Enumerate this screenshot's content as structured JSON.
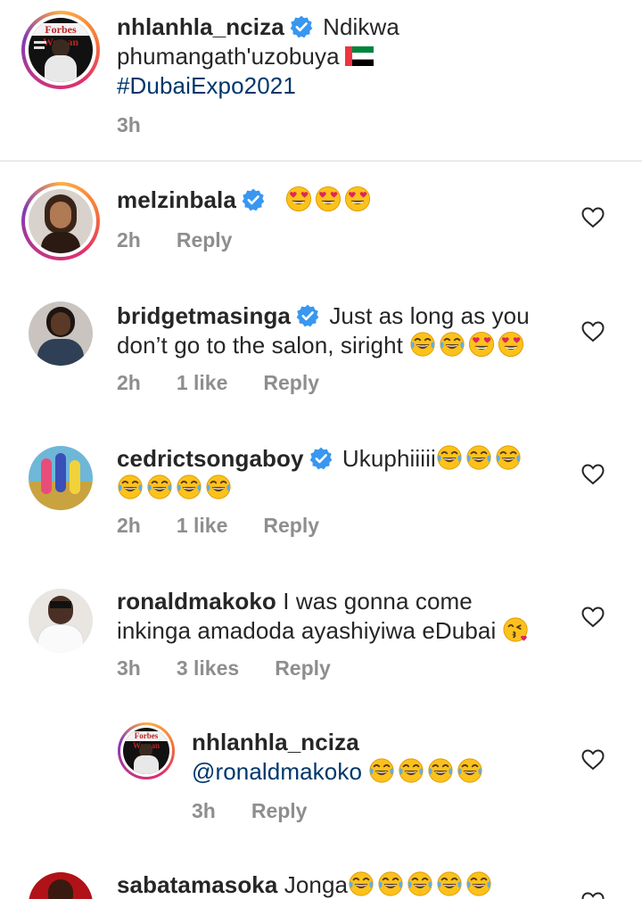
{
  "caption": {
    "username": "nhlanhla_nciza",
    "text_line1": "Ndikwa",
    "text_line2": "phumangath'uzobuya",
    "hashtag": "#DubaiExpo2021",
    "time": "3h",
    "avatar_label": "Forbes Woman"
  },
  "comments": [
    {
      "username": "melzinbala",
      "verified": true,
      "text": "",
      "emojis": [
        "heart-eyes",
        "heart-eyes",
        "heart-eyes"
      ],
      "time": "2h",
      "likes": "",
      "reply": "Reply"
    },
    {
      "username": "bridgetmasinga",
      "verified": true,
      "text_line1": "Just as long as you",
      "text_line2": "don’t go to the salon, siright",
      "emojis": [
        "tears-of-joy",
        "tears-of-joy",
        "heart-eyes",
        "heart-eyes"
      ],
      "time": "2h",
      "likes": "1 like",
      "reply": "Reply"
    },
    {
      "username": "cedrictsongaboy",
      "verified": true,
      "text_line1": "Ukuphiiiii",
      "emojis_line1": [
        "tears-of-joy",
        "tears-of-joy",
        "tears-of-joy"
      ],
      "emojis_line2": [
        "tears-of-joy",
        "tears-of-joy",
        "tears-of-joy",
        "tears-of-joy"
      ],
      "time": "2h",
      "likes": "1 like",
      "reply": "Reply"
    },
    {
      "username": "ronaldmakoko",
      "verified": false,
      "text_line1": "I was gonna come",
      "text_line2": "inkinga amadoda ayashiyiwa eDubai",
      "emojis": [
        "kissing-heart"
      ],
      "time": "3h",
      "likes": "3 likes",
      "reply": "Reply"
    },
    {
      "username": "nhlanhla_nciza",
      "verified": false,
      "mention": "@ronaldmakoko",
      "emojis": [
        "tears-of-joy",
        "tears-of-joy",
        "tears-of-joy",
        "tears-of-joy"
      ],
      "time": "3h",
      "reply": "Reply",
      "avatar_label": "Forbes Woman"
    },
    {
      "username": "sabatamasoka",
      "verified": false,
      "text_line1": "Jonga",
      "emojis": [
        "tears-of-joy",
        "tears-of-joy",
        "tears-of-joy",
        "tears-of-joy",
        "tears-of-joy"
      ]
    }
  ],
  "colors": {
    "verified_blue": "#3897f0",
    "meta_gray": "#8e8e8e",
    "text": "#262626",
    "emoji_yellow": "#fcc21b"
  }
}
